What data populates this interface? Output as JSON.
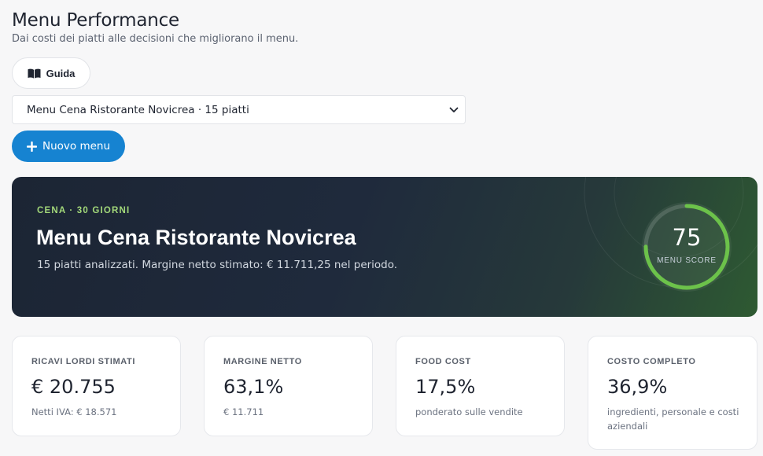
{
  "header": {
    "title": "Menu Performance",
    "subtitle": "Dai costi dei piatti alle decisioni che migliorano il menu."
  },
  "toolbar": {
    "guide_label": "Guida",
    "guide_icon": "book-icon",
    "menu_select_value": "Menu Cena Ristorante Novicrea · 15 piatti",
    "new_menu_label": "Nuovo menu",
    "new_menu_icon": "plus-icon"
  },
  "hero": {
    "eyebrow": "CENA · 30 GIORNI",
    "title": "Menu Cena Ristorante Novicrea",
    "description": "15 piatti analizzati. Margine netto stimato: € 11.711,25 nel periodo.",
    "score_value": "75",
    "score_label": "MENU SCORE",
    "score_fraction": 0.75,
    "score_color": "#6cc24a"
  },
  "kpis": [
    {
      "label": "RICAVI LORDI STIMATI",
      "value": "€ 20.755",
      "note": "Netti IVA: € 18.571"
    },
    {
      "label": "MARGINE NETTO",
      "value": "63,1%",
      "note": "€ 11.711"
    },
    {
      "label": "FOOD COST",
      "value": "17,5%",
      "note": "ponderato sulle vendite"
    },
    {
      "label": "COSTO COMPLETO",
      "value": "36,9%",
      "note": "ingredienti, personale e costi aziendali"
    }
  ],
  "colors": {
    "accent": "#1683d1",
    "eyebrow": "#a3d97a"
  }
}
